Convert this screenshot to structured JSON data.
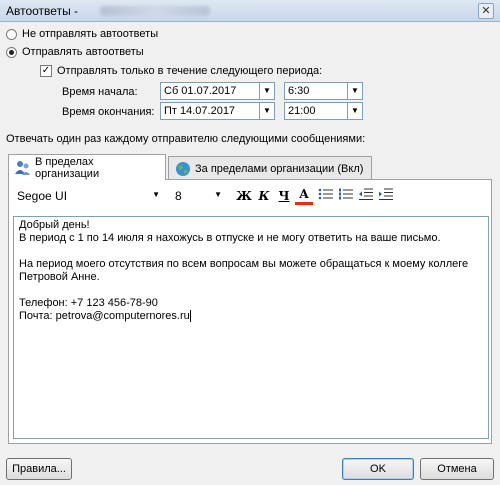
{
  "window": {
    "title": "Автоответы -",
    "close_label": "✕"
  },
  "options": {
    "no_send": "Не отправлять автоответы",
    "send": "Отправлять автоответы",
    "period_only": "Отправлять только в течение следующего периода:"
  },
  "period": {
    "start_label": "Время начала:",
    "start_date": "Сб 01.07.2017",
    "start_time": "6:30",
    "end_label": "Время окончания:",
    "end_date": "Пт 14.07.2017",
    "end_time": "21:00"
  },
  "reply_once": "Отвечать один раз каждому отправителю следующими сообщениями:",
  "tabs": [
    {
      "label": "В пределах организации"
    },
    {
      "label": "За пределами организации (Вкл)"
    }
  ],
  "toolbar": {
    "font": "Segoe UI",
    "size": "8",
    "bold": "Ж",
    "italic": "К",
    "underline": "Ч",
    "font_color": "А",
    "font_color_hex": "#e03010"
  },
  "message": {
    "lines": [
      "Добрый день!",
      "В период с 1 по 14 июля я нахожусь в отпуске и не могу ответить на ваше письмо.",
      "",
      "На период моего отсутствия по всем вопросам вы можете обращаться к моему коллеге",
      "Петровой Анне.",
      "",
      "Телефон: +7 123 456-78-90",
      "Почта: petrova@computernores.ru"
    ]
  },
  "buttons": {
    "rules": "Правила...",
    "ok": "OK",
    "cancel": "Отмена"
  }
}
